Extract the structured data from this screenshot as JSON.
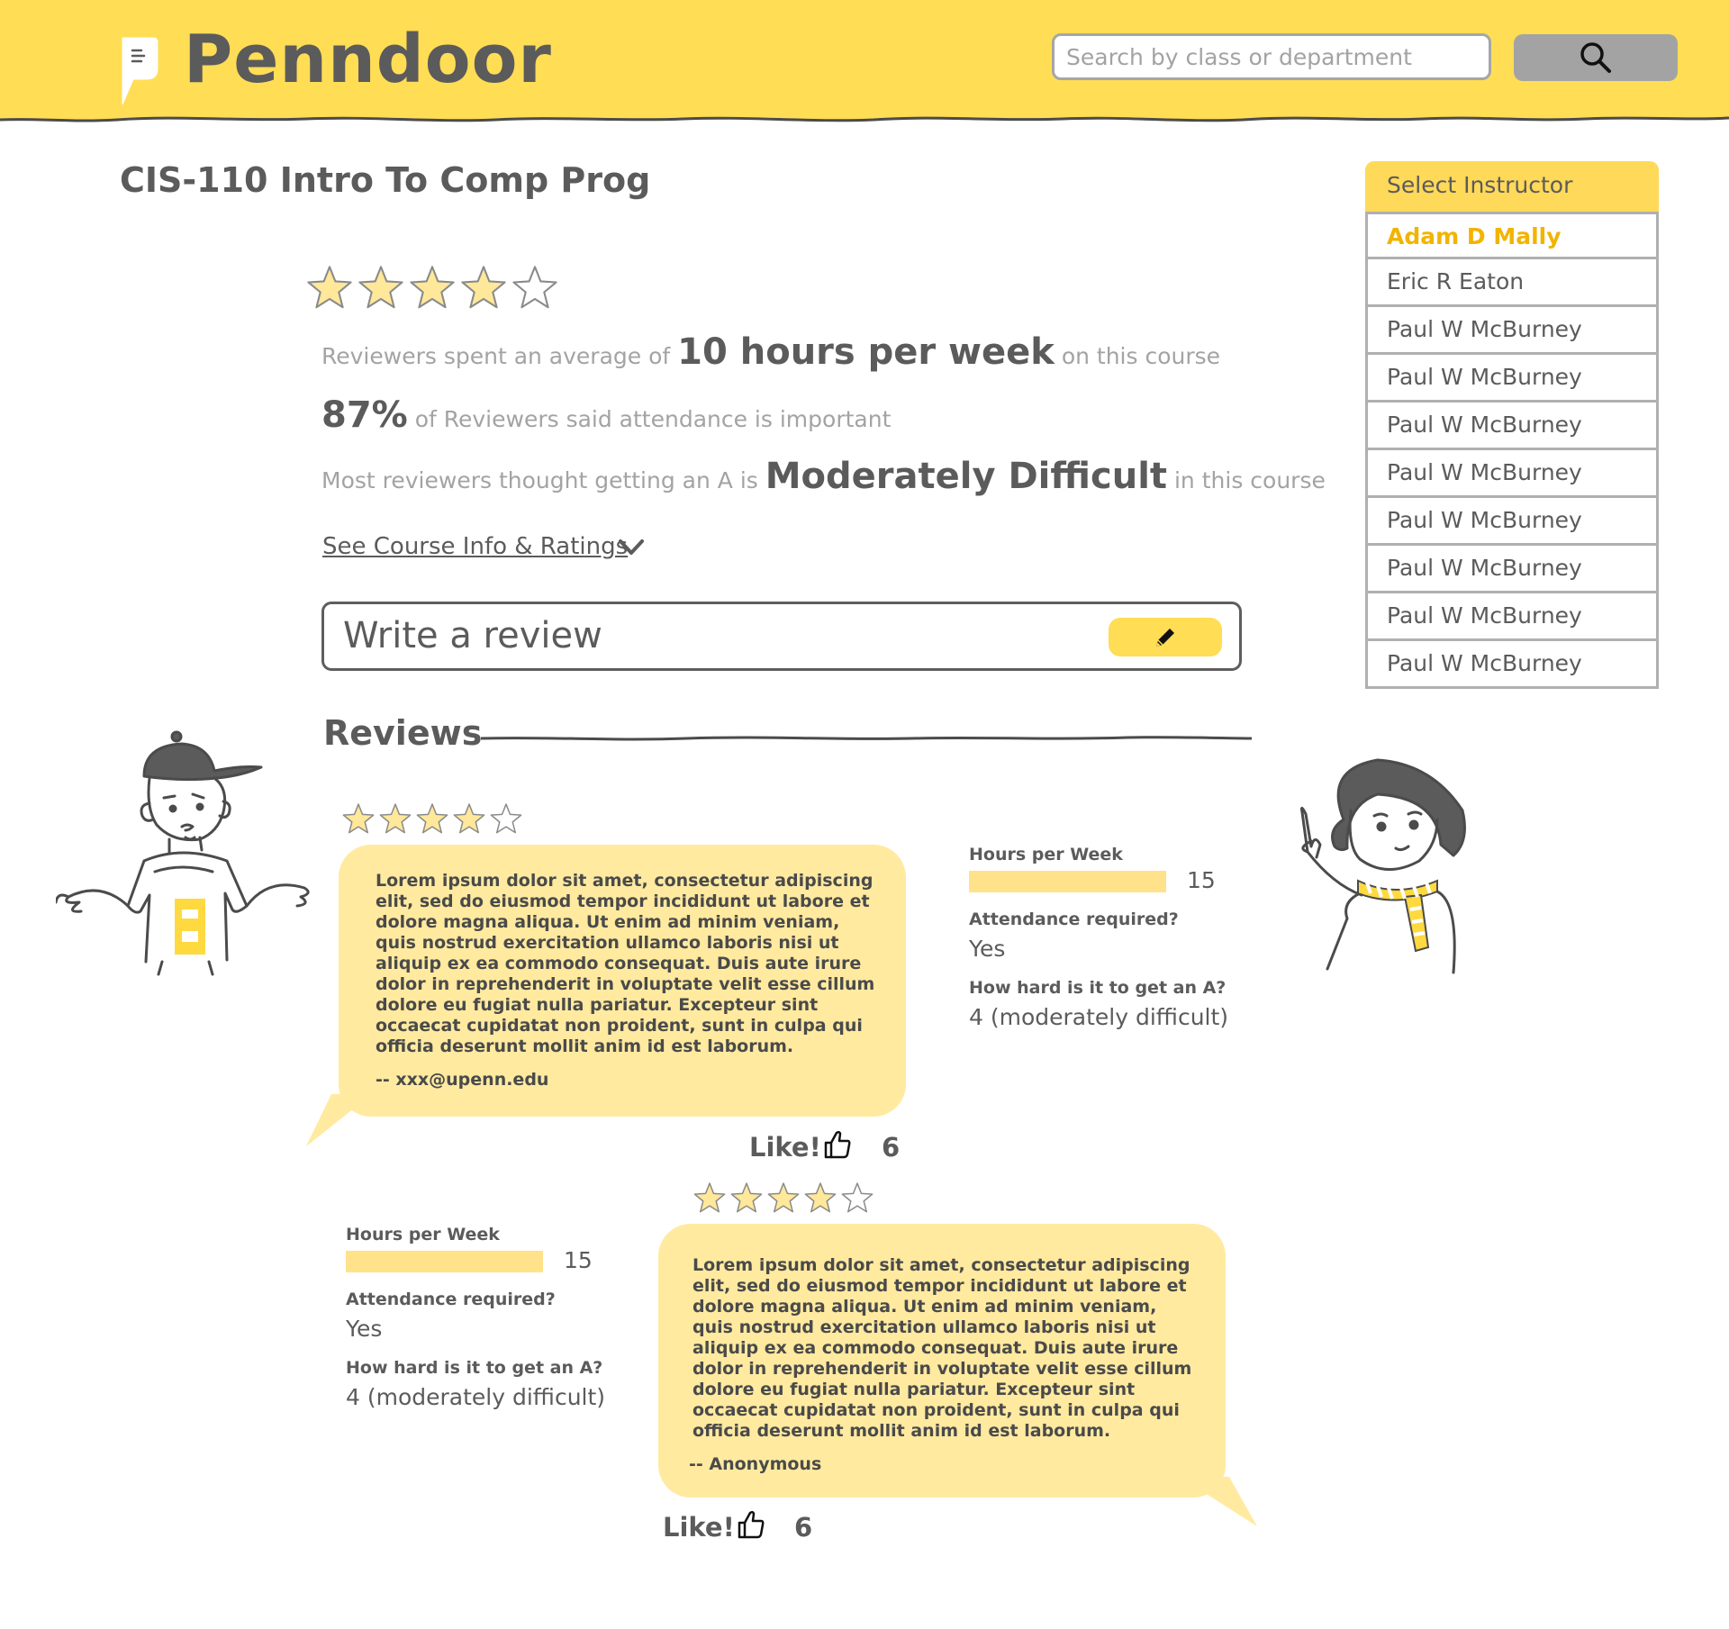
{
  "header": {
    "brand": "Penndoor",
    "search_placeholder": "Search by class or department",
    "bg_color": "#ffdd55"
  },
  "course": {
    "title": "CIS-110 Intro To Comp Prog",
    "rating": 4,
    "rating_max": 5,
    "hours": {
      "prefix": "Reviewers spent an average of",
      "value": "10 hours per week",
      "suffix": "on this course"
    },
    "attendance": {
      "value": "87%",
      "suffix": "of Reviewers said attendance is important"
    },
    "difficulty": {
      "prefix": "Most reviewers thought getting an A is",
      "value": "Moderately Difficult",
      "suffix": "in this course"
    },
    "info_link": "See Course Info & Ratings",
    "write_review_label": "Write a review"
  },
  "instructors": {
    "header": "Select Instructor",
    "items": [
      "Adam D Mally",
      "Eric R Eaton",
      "Paul W McBurney",
      "Paul W McBurney",
      "Paul W McBurney",
      "Paul W McBurney",
      "Paul W McBurney",
      "Paul W McBurney",
      "Paul W McBurney",
      "Paul W McBurney"
    ],
    "active_color": "#f2b400"
  },
  "reviews": {
    "title": "Reviews",
    "items": [
      {
        "rating": 4,
        "text": "Lorem ipsum dolor sit amet, consectetur adipiscing elit, sed do eiusmod tempor incididunt ut labore et dolore magna aliqua. Ut enim ad minim veniam, quis nostrud exercitation ullamco laboris nisi ut aliquip ex ea commodo consequat. Duis aute irure dolor in reprehenderit in voluptate velit esse cillum dolore eu fugiat nulla pariatur. Excepteur sint occaecat cupidatat non proident, sunt in culpa qui officia deserunt mollit anim id est laborum.",
        "author": "-- xxx@upenn.edu",
        "hours_label": "Hours per Week",
        "hours_value": "15",
        "attendance_label": "Attendance required?",
        "attendance_value": "Yes",
        "difficulty_label": "How hard is it to get an A?",
        "difficulty_value": "4 (moderately difficult)",
        "like_label": "Like!",
        "likes": "6"
      },
      {
        "rating": 4,
        "text": "Lorem ipsum dolor sit amet, consectetur adipiscing elit, sed do eiusmod tempor incididunt ut labore et dolore magna aliqua. Ut enim ad minim veniam, quis nostrud exercitation ullamco laboris nisi ut aliquip ex ea commodo consequat. Duis aute irure dolor in reprehenderit in voluptate velit esse cillum dolore eu fugiat nulla pariatur. Excepteur sint occaecat cupidatat non proident, sunt in culpa qui officia deserunt mollit anim id est laborum.",
        "author": "-- Anonymous",
        "hours_label": "Hours per Week",
        "hours_value": "15",
        "attendance_label": "Attendance required?",
        "attendance_value": "Yes",
        "difficulty_label": "How hard is it to get an A?",
        "difficulty_value": "4 (moderately difficult)",
        "like_label": "Like!",
        "likes": "6"
      }
    ],
    "bubble_color": "#ffeaa0"
  },
  "icons": {
    "logo": "speech-bubble-logo-icon",
    "search": "search-icon",
    "chevron": "chevron-down-icon",
    "pencil": "pencil-icon",
    "like": "thumbs-up-icon",
    "star": "star-icon"
  }
}
